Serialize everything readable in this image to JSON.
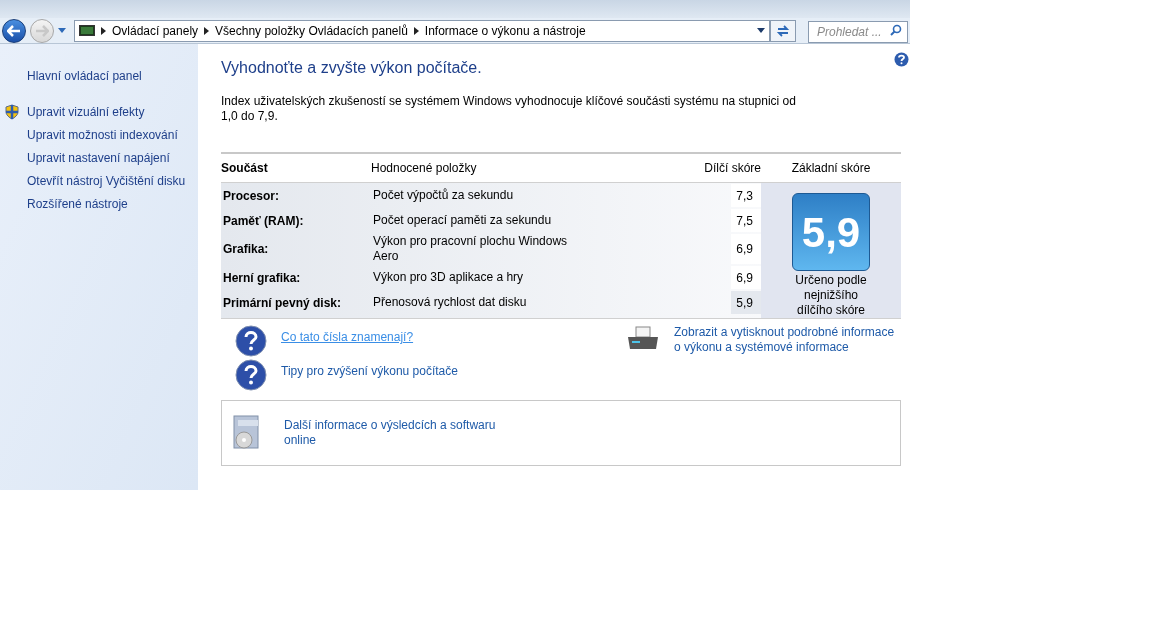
{
  "address_bar": {
    "breadcrumbs": [
      "Ovládací panely",
      "Všechny položky Ovládacích panelů",
      "Informace o výkonu a nástroje"
    ],
    "search_placeholder": "Prohledat ..."
  },
  "sidebar": {
    "items": [
      {
        "label": "Hlavní ovládací panel",
        "kind": "plain"
      },
      {
        "label": "Upravit vizuální efekty",
        "kind": "shield"
      },
      {
        "label": "Upravit možnosti indexování",
        "kind": "plain"
      },
      {
        "label": "Upravit nastavení napájení",
        "kind": "plain"
      },
      {
        "label": "Otevřít nástroj Vyčištění disku",
        "kind": "plain"
      },
      {
        "label": "Rozšířené nástroje",
        "kind": "plain"
      }
    ]
  },
  "title": "Vyhodnoťte a zvyšte výkon počítače.",
  "description": "Index uživatelských zkušeností se systémem Windows vyhodnocuje klíčové součásti systému na stupnici od 1,0 do 7,9.",
  "table": {
    "columns": [
      "Součást",
      "Hodnocené položky",
      "Dílčí skóre",
      "Základní skóre"
    ],
    "rows": [
      {
        "component": "Procesor:",
        "item": "Počet výpočtů za sekundu",
        "score": "7,3",
        "lowest": false
      },
      {
        "component": "Paměť (RAM):",
        "item": "Počet operací paměti za sekundu",
        "score": "7,5",
        "lowest": false
      },
      {
        "component": "Grafika:",
        "item": "Výkon pro pracovní plochu Windows Aero",
        "score": "6,9",
        "lowest": false
      },
      {
        "component": "Herní grafika:",
        "item": "Výkon pro 3D aplikace a hry",
        "score": "6,9",
        "lowest": false
      },
      {
        "component": "Primární pevný disk:",
        "item": "Přenosová rychlost dat disku",
        "score": "5,9",
        "lowest": true
      }
    ],
    "base_score": "5,9",
    "base_caption": "Určeno podle nejnižšího dílčího skóre"
  },
  "help_links": [
    {
      "label": "Co tato čísla znamenají?",
      "hovered": true
    },
    {
      "label": "Tipy pro zvýšení výkonu počítače",
      "hovered": false
    }
  ],
  "print_link": "Zobrazit a vytisknout podrobné informace o výkonu a systémové informace",
  "online_link": "Další informace o výsledcích a softwaru online"
}
